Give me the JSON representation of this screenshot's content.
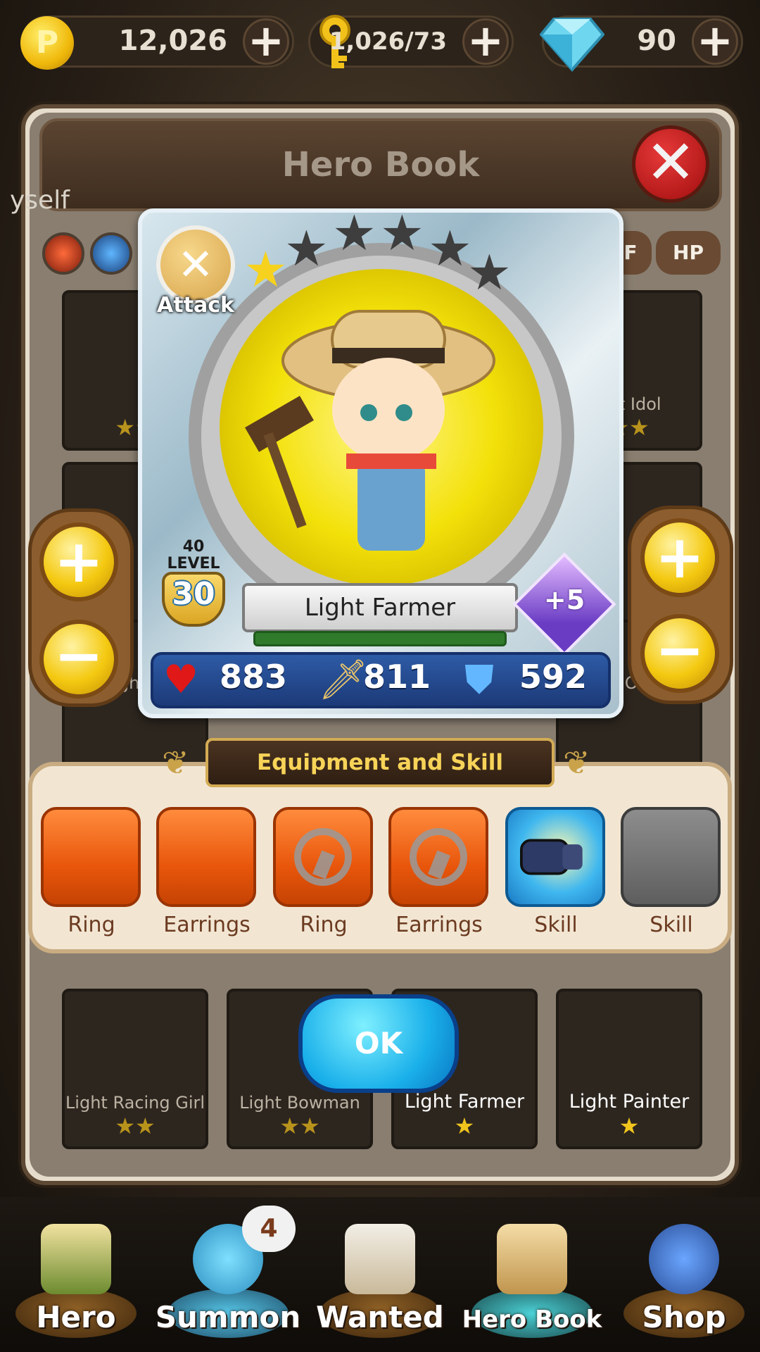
{
  "currency": {
    "coins": "12,026",
    "keys": "1,026/73",
    "gems": "90"
  },
  "panel": {
    "title": "Hero Book",
    "side_text": "yself",
    "filters": [
      "F",
      "HP"
    ]
  },
  "background_cards": [
    {
      "name": "",
      "stars": "★★"
    },
    {
      "name": "ght Idol",
      "stars": "★★"
    },
    {
      "name": "Light M",
      "stars": ""
    },
    {
      "name": "Light Officer",
      "stars": ""
    },
    {
      "name": "Light Racing Girl",
      "stars": "★★"
    },
    {
      "name": "Light Bowman",
      "stars": "★★"
    },
    {
      "name": "Light Farmer",
      "stars": "★"
    },
    {
      "name": "Light Painter",
      "stars": "★"
    }
  ],
  "hero": {
    "class_label": "Attack",
    "stars_filled": 1,
    "stars_total": 6,
    "max_level": "40",
    "level_label": "LEVEL",
    "level": "30",
    "name": "Light Farmer",
    "enhance": "+5",
    "hp": "883",
    "attack": "811",
    "defense": "592",
    "xp_fraction": 1.0
  },
  "equipment": {
    "title": "Equipment and Skill",
    "slots": [
      {
        "label": "Ring",
        "state": "equipped"
      },
      {
        "label": "Earrings",
        "state": "equipped"
      },
      {
        "label": "Ring",
        "state": "locked"
      },
      {
        "label": "Earrings",
        "state": "locked"
      },
      {
        "label": "Skill",
        "state": "skill"
      },
      {
        "label": "Skill",
        "state": "empty"
      }
    ]
  },
  "ok_label": "OK",
  "nav": {
    "items": [
      "Hero",
      "Summon",
      "Wanted",
      "Hero Book",
      "Shop"
    ],
    "summon_badge": "4"
  },
  "colors": {
    "accent_gold": "#f4c911",
    "ok_blue": "#1ab0ea",
    "equip_orange": "#e8560b",
    "stats_blue": "#1c3a78"
  }
}
